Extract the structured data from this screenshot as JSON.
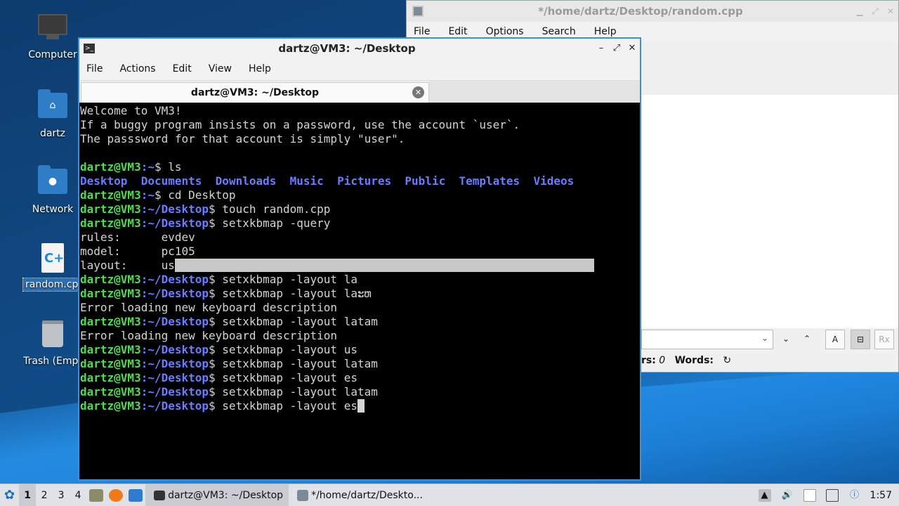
{
  "desktop": {
    "icons": [
      {
        "label": "Computer",
        "icon": "computer-icon"
      },
      {
        "label": "dartz",
        "icon": "home-folder-icon"
      },
      {
        "label": "Network",
        "icon": "network-folder-icon"
      },
      {
        "label": "random.cpp",
        "icon": "cpp-file-icon"
      },
      {
        "label": "Trash (Empt",
        "icon": "trash-icon"
      }
    ]
  },
  "editor": {
    "title": "*/home/dartz/Desktop/random.cpp",
    "menu": [
      "File",
      "Edit",
      "Options",
      "Search",
      "Help"
    ],
    "find_buttons": [
      "⌄",
      "⌃",
      "A",
      "⊟",
      "Rx"
    ],
    "status_chars_label": "rs:",
    "status_chars_value": "0",
    "status_words_label": "Words:",
    "status_refresh_icon": "refresh-icon"
  },
  "terminal": {
    "title": "dartz@VM3: ~/Desktop",
    "menu": [
      "File",
      "Actions",
      "Edit",
      "View",
      "Help"
    ],
    "tab_label": "dartz@VM3: ~/Desktop",
    "lines": {
      "welcome1": "Welcome to VM3!",
      "welcome2": "If a buggy program insists on a password, use the account `user`.",
      "welcome3": "The passsword for that account is simply \"user\".",
      "prompt_user": "dartz@VM3",
      "home_path": ":~",
      "desk_path": ":~/Desktop",
      "cmd_ls": "$ ls",
      "ls_out": [
        "Desktop",
        "Documents",
        "Downloads",
        "Music",
        "Pictures",
        "Public",
        "Templates",
        "Videos"
      ],
      "cmd_cd": "$ cd Desktop",
      "cmd_touch": "$ touch random.cpp",
      "cmd_query": "$ setxkbmap -query",
      "rules": "rules:      evdev",
      "model": "model:      pc105",
      "layout_key": "layout:     ",
      "layout_val": "us",
      "cmd_la": "$ setxkbmap -layout la",
      "cmd_laerr": "$ setxkbmap -layout laະຫ",
      "error": "Error loading new keyboard description",
      "cmd_latam": "$ setxkbmap -layout latam",
      "cmd_us": "$ setxkbmap -layout us",
      "cmd_es": "$ setxkbmap -layout es"
    }
  },
  "taskbar": {
    "workspaces": [
      "1",
      "2",
      "3",
      "4"
    ],
    "tasks": [
      {
        "label": "dartz@VM3: ~/Desktop",
        "icon": "terminal-icon"
      },
      {
        "label": "*/home/dartz/Deskto...",
        "icon": "text-editor-icon"
      }
    ],
    "clock": "1:57"
  },
  "colors": {
    "prompt_user": "#4fdc4f",
    "prompt_path": "#6a7cff",
    "window_border_active": "#3f8fd8"
  }
}
